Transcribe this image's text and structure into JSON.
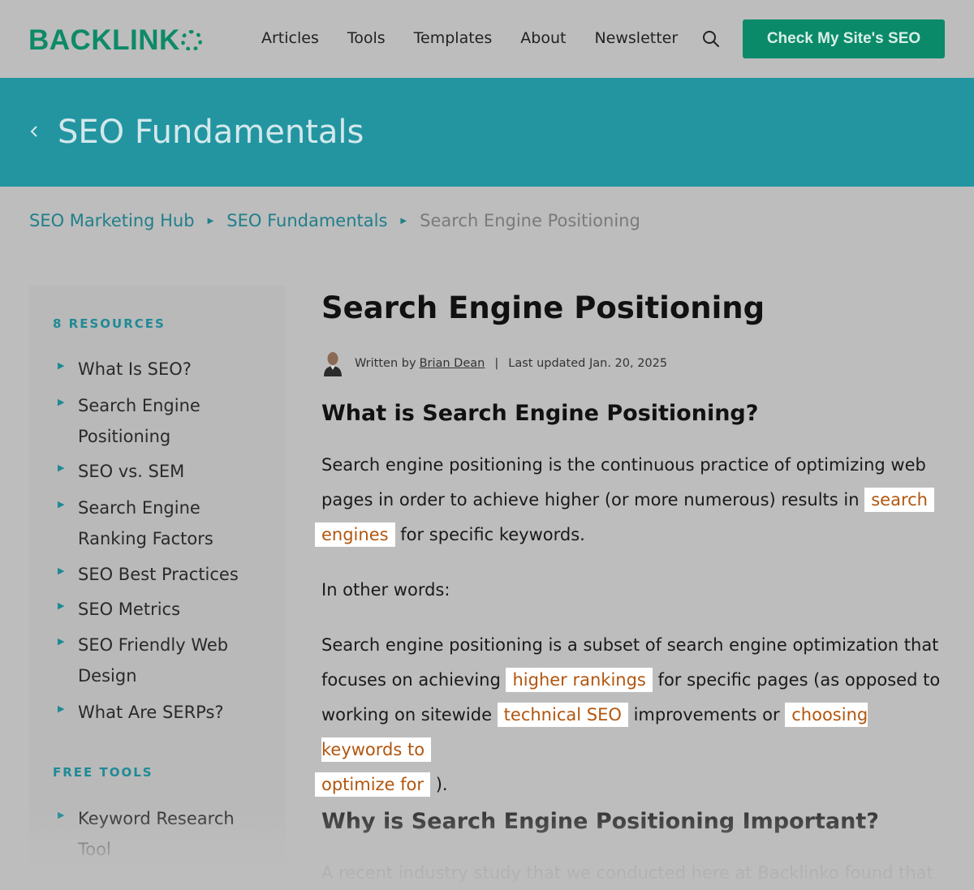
{
  "header": {
    "logo_text": "BACKLINK",
    "nav": [
      "Articles",
      "Tools",
      "Templates",
      "About",
      "Newsletter"
    ],
    "search_icon": "search-icon",
    "cta_label": "Check My Site's SEO",
    "brand_color": "#0b8a6a"
  },
  "banner": {
    "title": "SEO Fundamentals",
    "back_icon": "chevron-left-icon",
    "color": "#2295a1"
  },
  "breadcrumb": {
    "items": [
      "SEO Marketing Hub",
      "SEO Fundamentals"
    ],
    "current": "Search Engine Positioning"
  },
  "sidebar": {
    "resources_heading": "8 RESOURCES",
    "resources": [
      "What Is SEO?",
      "Search Engine Positioning",
      "SEO vs. SEM",
      "Search Engine Ranking Factors",
      "SEO Best Practices",
      "SEO Metrics",
      "SEO Friendly Web Design",
      "What Are SERPs?"
    ],
    "tools_heading": "FREE TOOLS",
    "tools": [
      "Keyword Research Tool"
    ]
  },
  "article": {
    "title": "Search Engine Positioning",
    "byline": {
      "written_by": "Written by",
      "author": "Brian Dean",
      "separator": "|",
      "updated": "Last updated Jan. 20, 2025"
    },
    "section1_heading": "What is Search Engine Positioning?",
    "p1": {
      "text_a": "Search engine positioning is the continuous practice of optimizing web pages in order to achieve higher (or more numerous) results in ",
      "link_search_a": "search",
      "link_search_b": "engines",
      "text_b": " for specific keywords."
    },
    "p2": "In other words:",
    "p3": {
      "text_a": "Search engine positioning is a subset of search engine optimization that focuses on achieving ",
      "link_rankings": "higher rankings",
      "text_b": " for specific pages (as opposed to working on sitewide ",
      "link_technical": "technical SEO",
      "text_c": " improvements or ",
      "link_keywords_a": "choosing keywords to",
      "link_keywords_b": "optimize for",
      "text_d": " )."
    },
    "section2_heading": "Why is Search Engine Positioning Important?",
    "p4": "A recent industry study that we conducted here at Backlinko found that"
  },
  "colors": {
    "link_highlight_text": "#b2560e",
    "accent_teal": "#1f8a96"
  }
}
